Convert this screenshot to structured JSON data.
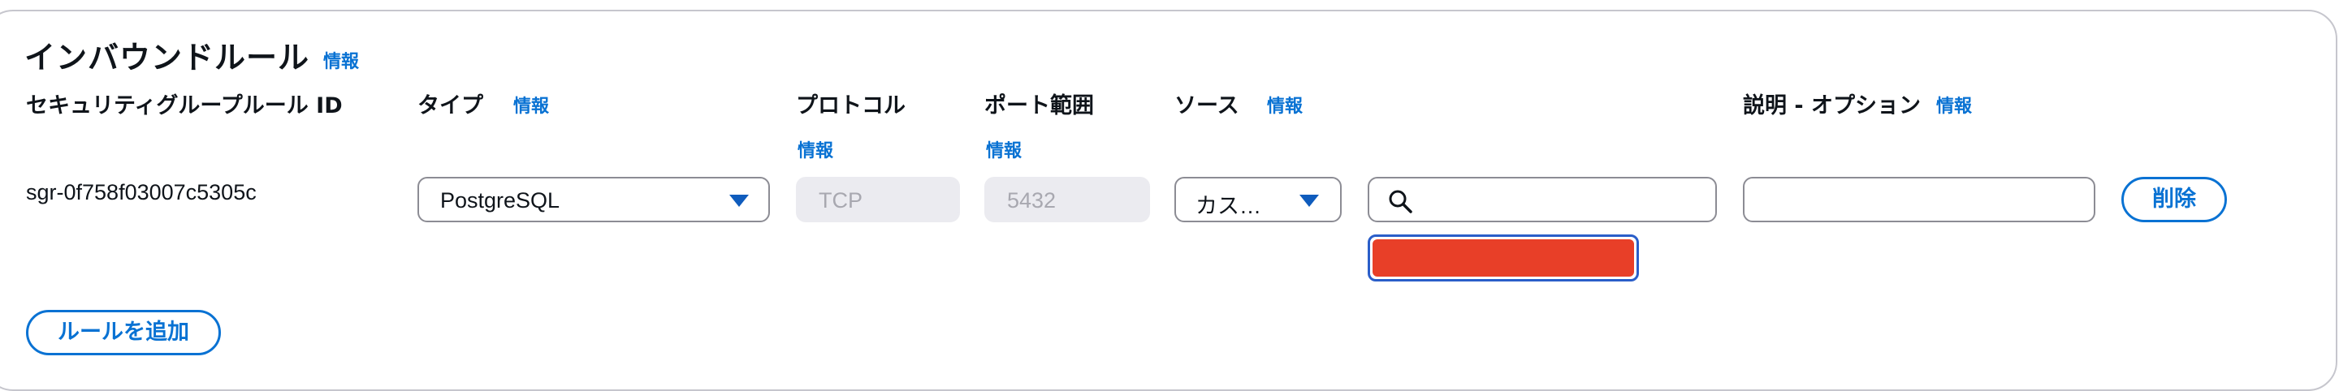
{
  "panel": {
    "title": "インバウンドルール",
    "info_label": "情報"
  },
  "columns": {
    "rule_id": "セキュリティグループルール ID",
    "type": "タイプ",
    "protocol": "プロトコル",
    "port_range": "ポート範囲",
    "source": "ソース",
    "description": "説明 - オプション"
  },
  "rule": {
    "id": "sgr-0f758f03007c5305c",
    "type": "PostgreSQL",
    "protocol": "TCP",
    "port": "5432",
    "source_type": "カス…",
    "source_search_value": "",
    "description_value": ""
  },
  "buttons": {
    "delete": "削除",
    "add_rule": "ルールを追加"
  },
  "colors": {
    "accent": "#0972d3",
    "error_fill": "#e83f28",
    "disabled_bg": "#ebebf0"
  }
}
